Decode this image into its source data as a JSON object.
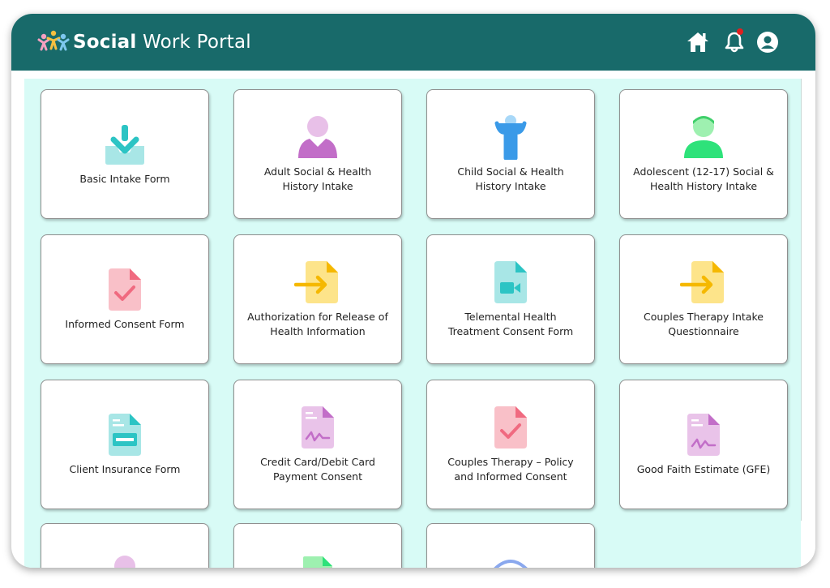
{
  "header": {
    "brand_bold": "Social",
    "brand_rest": " Work Portal",
    "bg_color": "#186a6a",
    "icons": [
      "home-icon",
      "bell-icon",
      "account-icon"
    ]
  },
  "forms": [
    {
      "label": "Basic Intake Form",
      "icon": "download-tray-icon"
    },
    {
      "label": "Adult Social & Health History Intake",
      "icon": "adult-person-icon"
    },
    {
      "label": "Child Social & Health History Intake",
      "icon": "child-icon"
    },
    {
      "label": "Adolescent (12-17) Social & Health History Intake",
      "icon": "adolescent-person-icon"
    },
    {
      "label": "Informed Consent Form",
      "icon": "check-document-icon"
    },
    {
      "label": "Authorization for Release of Health Information",
      "icon": "arrow-document-icon"
    },
    {
      "label": "Telemental Health Treatment Consent Form",
      "icon": "video-document-icon"
    },
    {
      "label": "Couples Therapy Intake Questionnaire",
      "icon": "arrow-document-icon"
    },
    {
      "label": "Client Insurance Form",
      "icon": "card-document-icon"
    },
    {
      "label": "Credit Card/Debit Card Payment Consent",
      "icon": "signature-document-icon"
    },
    {
      "label": "Couples Therapy – Policy and Informed Consent",
      "icon": "check-document-icon"
    },
    {
      "label": "Good Faith Estimate (GFE)",
      "icon": "signature-document-icon"
    }
  ],
  "colors": {
    "content_bg": "#d8fbf6",
    "teal": "#a8e6e6",
    "pink": "#f9c0c8",
    "yellow": "#fde48a",
    "purple": "#e9c3e9"
  }
}
